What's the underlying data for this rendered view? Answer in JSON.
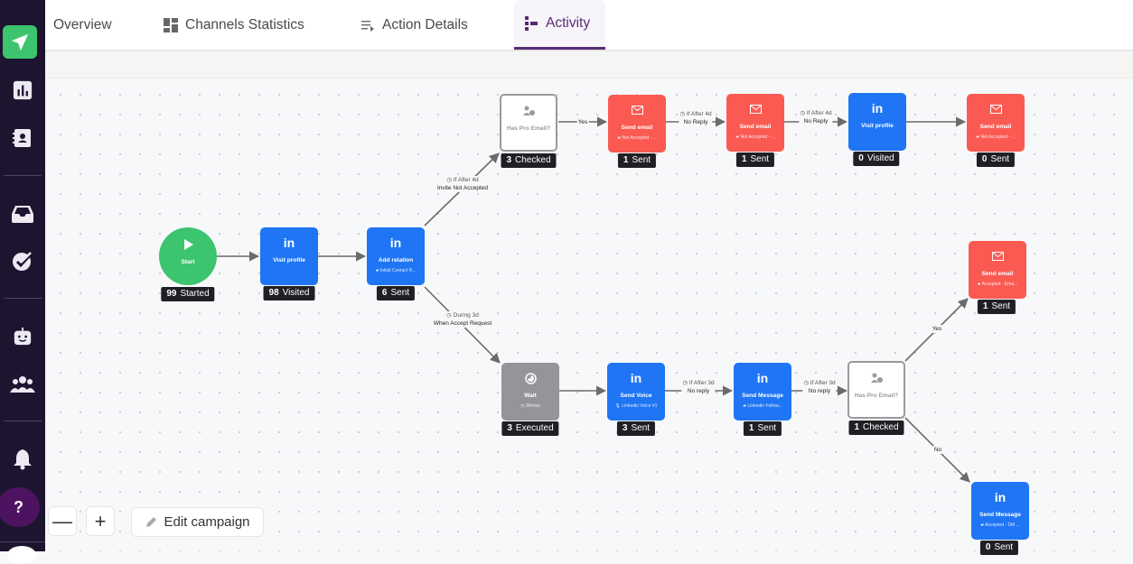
{
  "sidebar": {
    "items": [
      {
        "name": "campaigns",
        "icon": "paper-plane-icon",
        "active": true
      },
      {
        "name": "analytics",
        "icon": "bar-chart-icon"
      },
      {
        "name": "contacts",
        "icon": "address-book-icon"
      },
      {
        "name": "inbox",
        "icon": "inbox-icon"
      },
      {
        "name": "tasks",
        "icon": "check-circle-icon"
      },
      {
        "name": "bot",
        "icon": "robot-icon"
      },
      {
        "name": "team",
        "icon": "users-icon"
      },
      {
        "name": "notifications",
        "icon": "bell-icon"
      }
    ],
    "help_label": "?"
  },
  "tabs": [
    {
      "label": "Overview",
      "icon": ""
    },
    {
      "label": "Channels Statistics",
      "icon": "grid-icon"
    },
    {
      "label": "Action Details",
      "icon": "list-icon"
    },
    {
      "label": "Activity",
      "icon": "flow-icon",
      "active": true
    }
  ],
  "colors": {
    "accent": "#5b2a73",
    "linkedin_blue": "#1f75f3",
    "email_red": "#fa5a52",
    "start_green": "#3cc46f",
    "wait_gray": "#939598",
    "sidebar_bg": "#1d1530"
  },
  "nodes": {
    "start": {
      "title": "Start",
      "count": "99",
      "status": "Started"
    },
    "visit1": {
      "title": "Visit profile",
      "count": "98",
      "status": "Visited"
    },
    "add_relation": {
      "title": "Add relation",
      "sub": "Initial Contact R...",
      "count": "6",
      "status": "Sent"
    },
    "pro_email_top": {
      "title": "Has Pro Email?",
      "count": "3",
      "status": "Checked"
    },
    "email1": {
      "title": "Send email",
      "sub": "Not Accepted - ...",
      "count": "1",
      "status": "Sent"
    },
    "email2": {
      "title": "Send email",
      "sub": "Not Accepted - ...",
      "count": "1",
      "status": "Sent"
    },
    "visit2": {
      "title": "Visit profile",
      "count": "0",
      "status": "Visited"
    },
    "email3": {
      "title": "Send email",
      "sub": "Not Accepted - ...",
      "count": "0",
      "status": "Sent"
    },
    "wait": {
      "title": "Wait",
      "sub": "30mins",
      "count": "3",
      "status": "Executed"
    },
    "voice": {
      "title": "Send Voice",
      "sub": "Linkedin Voice #1",
      "count": "3",
      "status": "Sent"
    },
    "message1": {
      "title": "Send Message",
      "sub": "Linkedin Follow...",
      "count": "1",
      "status": "Sent"
    },
    "pro_email_bottom": {
      "title": "Has Pro Email?",
      "count": "1",
      "status": "Checked"
    },
    "email_accepted": {
      "title": "Send email",
      "sub": "Accepted - Ema...",
      "count": "1",
      "status": "Sent"
    },
    "message_accepted": {
      "title": "Send Message",
      "sub": "Accepted - DM ...",
      "count": "0",
      "status": "Sent"
    }
  },
  "edges": {
    "not_accepted": {
      "cond": "If After 4d",
      "label": "Invite Not Accepted"
    },
    "accepted": {
      "cond": "During 3d",
      "label": "When Accept Request"
    },
    "yes_top": {
      "label": "Yes"
    },
    "no_reply1": {
      "cond": "If After 4d",
      "label": "No Reply"
    },
    "no_reply2": {
      "cond": "If After 4d",
      "label": "No Reply"
    },
    "no_reply3": {
      "cond": "If After 3d",
      "label": "No reply"
    },
    "no_reply4": {
      "cond": "If After 3d",
      "label": "No reply"
    },
    "yes_bottom": {
      "label": "Yes"
    },
    "no_bottom": {
      "label": "No"
    }
  },
  "controls": {
    "zoom_out": "—",
    "zoom_in": "+",
    "edit_campaign": "Edit campaign"
  }
}
